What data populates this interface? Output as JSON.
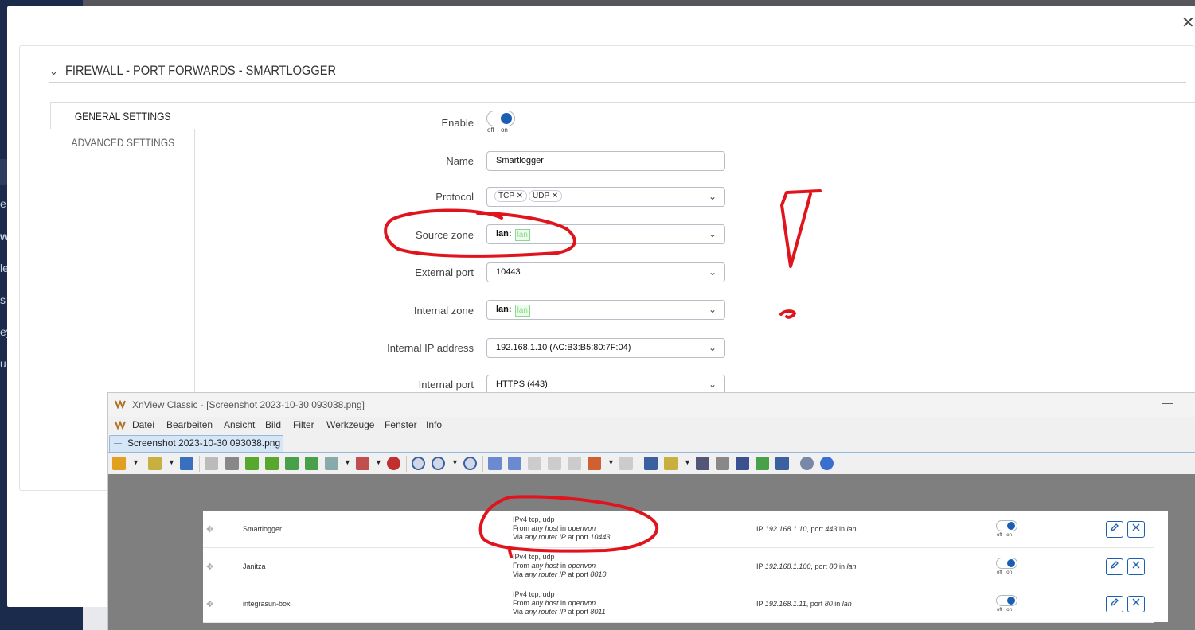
{
  "modal": {
    "section_title": "FIREWALL - PORT FORWARDS - SMARTLOGGER",
    "close_glyph": "✕",
    "tabs": {
      "general": "GENERAL SETTINGS",
      "advanced": "ADVANCED SETTINGS"
    },
    "fields": {
      "enable": {
        "label": "Enable",
        "off": "off",
        "on": "on",
        "state": true
      },
      "name": {
        "label": "Name",
        "value": "Smartlogger"
      },
      "protocol": {
        "label": "Protocol",
        "chips": [
          "TCP",
          "UDP"
        ]
      },
      "source_zone": {
        "label": "Source zone",
        "zone": "lan:",
        "badge": "lan"
      },
      "external_port": {
        "label": "External port",
        "value": "10443"
      },
      "internal_zone": {
        "label": "Internal zone",
        "zone": "lan:",
        "badge": "lan"
      },
      "internal_ip": {
        "label": "Internal IP address",
        "value": "192.168.1.10 (AC:B3:B5:80:7F:04)"
      },
      "internal_port": {
        "label": "Internal port",
        "value": "HTTPS (443)"
      }
    }
  },
  "background": {
    "sidebar_fragments": [
      "e",
      "wa",
      "le",
      "s",
      "ey",
      "u"
    ]
  },
  "xnview": {
    "title": "XnView Classic - [Screenshot 2023-10-30 093038.png]",
    "minimize": "—",
    "menu": [
      "Datei",
      "Bearbeiten",
      "Ansicht",
      "Bild",
      "Filter",
      "Werkzeuge",
      "Fenster",
      "Info"
    ],
    "tab": "Screenshot 2023-10-30 093038.png",
    "rules": [
      {
        "name": "Smartlogger",
        "proto": "IPv4 tcp, udp",
        "from_a": "From ",
        "from_host": "any host",
        "from_b": " in ",
        "from_zone": "openvpn",
        "via_a": "Via ",
        "via_ip": "any router IP",
        "via_b": " at port ",
        "via_port": "10443",
        "dest_a": "IP ",
        "dest_ip": "192.168.1.10",
        "dest_b": ", port ",
        "dest_port": "443",
        "dest_c": " in ",
        "dest_zone": "lan",
        "off": "off",
        "on": "on"
      },
      {
        "name": "Janitza",
        "proto": "IPv4 tcp, udp",
        "from_a": "From ",
        "from_host": "any host",
        "from_b": " in ",
        "from_zone": "openvpn",
        "via_a": "Via ",
        "via_ip": "any router IP",
        "via_b": " at port ",
        "via_port": "8010",
        "dest_a": "IP ",
        "dest_ip": "192.168.1.100",
        "dest_b": ", port ",
        "dest_port": "80",
        "dest_c": " in ",
        "dest_zone": "lan",
        "off": "off",
        "on": "on"
      },
      {
        "name": "integrasun-box",
        "proto": "IPv4 tcp, udp",
        "from_a": "From ",
        "from_host": "any host",
        "from_b": " in ",
        "from_zone": "openvpn",
        "via_a": "Via ",
        "via_ip": "any router IP",
        "via_b": " at port ",
        "via_port": "8011",
        "dest_a": "IP ",
        "dest_ip": "192.168.1.11",
        "dest_b": ", port ",
        "dest_port": "80",
        "dest_c": " in ",
        "dest_zone": "lan",
        "off": "off",
        "on": "on"
      }
    ]
  },
  "colors": {
    "accent": "#1a5fb4",
    "annotation": "#e0141c",
    "sidebar": "#1b2b4b"
  }
}
